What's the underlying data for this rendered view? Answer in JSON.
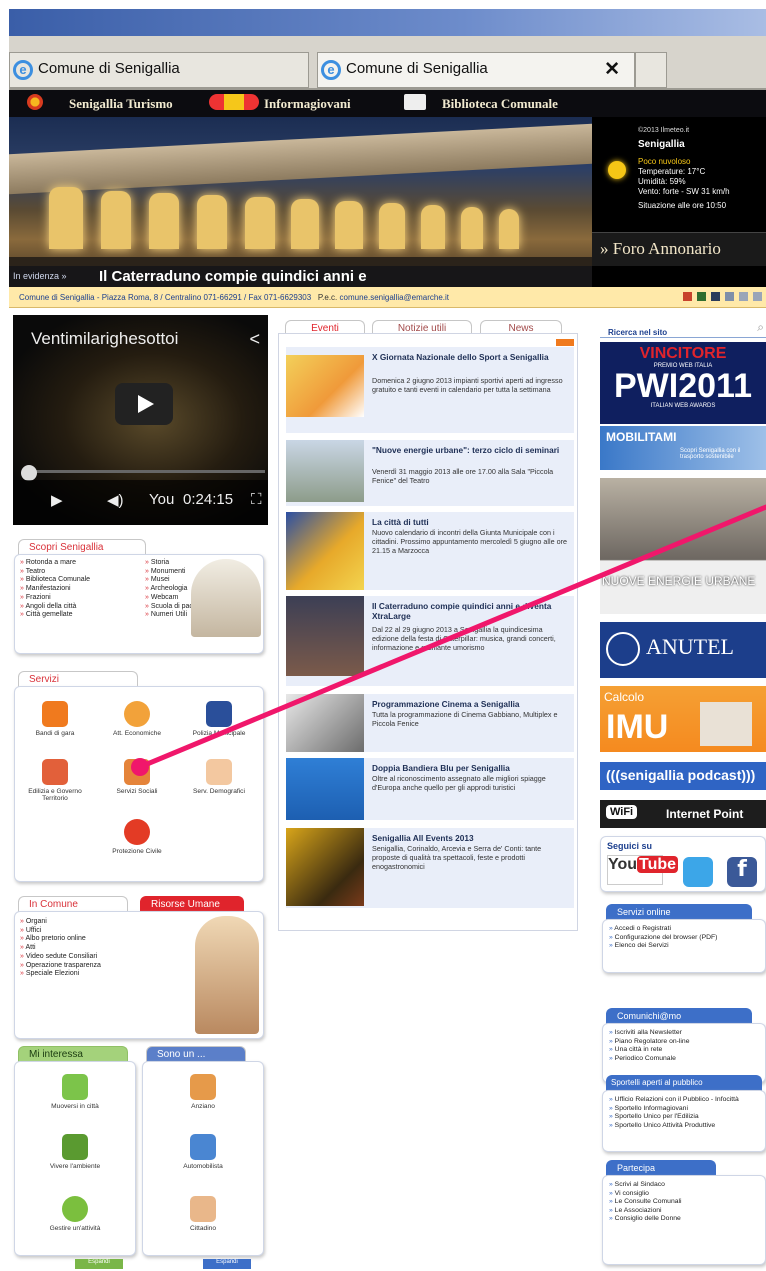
{
  "browser": {
    "tabs": [
      {
        "title": "Comune di Senigallia"
      },
      {
        "title": "Comune di Senigallia"
      }
    ],
    "close_glyph": "✕"
  },
  "topnav": {
    "items": [
      "Senigallia Turismo",
      "Informagiovani",
      "Biblioteca Comunale"
    ]
  },
  "meteo": {
    "copyright": "©2013 Ilmeteo.it",
    "city": "Senigallia",
    "condition": "Poco nuvoloso",
    "temp": "Temperature: 17°C",
    "humidity": "Umidità: 59%",
    "wind": "Vento: forte - SW 31 km/h",
    "updated": "Situazione alle ore 10:50"
  },
  "hero": {
    "place": "» Foro Annonario",
    "evidenza_label": "In evidenza »",
    "evidenza_title": "Il Caterraduno compie quindici anni e"
  },
  "address": {
    "text": "Comune di Senigallia - Piazza Roma, 8 / Centralino 071-66291 / Fax 071-6629303",
    "pec_label": "P.e.c.",
    "pec": "comune.senigallia@emarche.it"
  },
  "video": {
    "title": "Ventimilarighesottoi",
    "time": "0:24:15",
    "brand": "You"
  },
  "scopri": {
    "title": "Scopri Senigallia",
    "col1": [
      "Rotonda a mare",
      "Teatro",
      "Biblioteca Comunale",
      "Manifestazioni",
      "Frazioni",
      "Angoli della città",
      "Città gemellate"
    ],
    "col2": [
      "Storia",
      "Monumenti",
      "Musei",
      "Archeologia",
      "Webcam",
      "Scuola di pace",
      "Numeri Utili"
    ]
  },
  "servizi": {
    "title": "Servizi",
    "items": [
      "Bandi di gara",
      "Att. Economiche",
      "Polizia Municipale",
      "Edilizia e Governo Territorio",
      "Servizi Sociali",
      "Serv. Demografici",
      "Protezione Civile"
    ]
  },
  "in_comune": {
    "tab1": "In Comune",
    "tab2": "Risorse Umane",
    "items": [
      "Organi",
      "Uffici",
      "Albo pretorio online",
      "Atti",
      "Video sedute Consiliari",
      "Operazione trasparenza",
      "Speciale Elezioni"
    ]
  },
  "interessa": {
    "tab1": "Mi interessa",
    "tab2": "Sono un ...",
    "left": [
      "Muoversi in città",
      "Vivere l'ambiente",
      "Gestire un'attività"
    ],
    "right": [
      "Anziano",
      "Automobilista",
      "Cittadino"
    ],
    "expand": "Espandi"
  },
  "eventi": {
    "tabs": [
      "Eventi",
      "Notizie utili",
      "News"
    ],
    "items": [
      {
        "title": "X Giornata Nazionale dello Sport a Senigallia",
        "text": "Domenica 2 giugno 2013 impianti sportivi aperti ad ingresso gratuito e tanti eventi in calendario per tutta la settimana"
      },
      {
        "title": "\"Nuove energie urbane\": terzo ciclo di seminari",
        "text": "Venerdì 31 maggio 2013 alle ore 17.00 alla Sala \"Piccola Fenice\" del Teatro"
      },
      {
        "title": "La città di tutti",
        "text": "Nuovo calendario di incontri della Giunta Municipale con i cittadini. Prossimo appuntamento mercoledì 5 giugno alle ore 21.15 a Marzocca"
      },
      {
        "title": "Il Caterraduno compie quindici anni e diventa XtraLarge",
        "text": "Dal 22 al 29 giugno 2013 a Senigallia la quindicesima edizione della festa di Caterpillar: musica, grandi concerti, informazione e graffiante umorismo"
      },
      {
        "title": "Programmazione Cinema a Senigallia",
        "text": "Tutta la programmazione di Cinema Gabbiano, Multiplex e Piccola Fenice"
      },
      {
        "title": "Doppia Bandiera Blu per Senigallia",
        "text": "Oltre al riconoscimento assegnato alle migliori spiagge d'Europa anche quello per gli approdi turistici"
      },
      {
        "title": "Senigallia All Events 2013",
        "text": "Senigallia, Corinaldo, Arcevia e Serra de' Conti: tante proposte di qualità tra spettacoli, feste e prodotti enogastronomici"
      }
    ]
  },
  "sidebar": {
    "search_placeholder": "Ricerca nel sito",
    "pwi_top": "VINCITORE",
    "pwi_sub": "PREMIO WEB ITALIA",
    "pwi_big": "PWI2011",
    "pwi_foot": "ITALIAN WEB AWARDS",
    "mobilita": "MOBILITAMI",
    "mobilita_sub": "Scopri Senigallia con il trasporto sostenibile",
    "energie": "NUOVE ENERGIE URBANE",
    "anutel": "ANUTEL",
    "imu_label": "Calcolo",
    "imu": "IMU",
    "podcast": "(((senigallia podcast)))",
    "wifi": "Internet Point",
    "seguici": "Seguici su",
    "servizi_online": {
      "title": "Servizi online",
      "items": [
        "Accedi o Registrati",
        "Configurazione del browser (PDF)",
        "Elenco dei Servizi"
      ]
    },
    "comunichiamo": {
      "title": "Comunichi@mo",
      "items": [
        "Iscriviti alla Newsletter",
        "Piano Regolatore on-line",
        "Una città in rete",
        "Periodico Comunale"
      ]
    },
    "sportelli": {
      "title": "Sportelli aperti al pubblico",
      "items": [
        "Ufficio Relazioni con il Pubblico - Infocittà",
        "Sportello Informagiovani",
        "Sportello Unico per l'Edilizia",
        "Sportello Unico Attività Produttive"
      ]
    },
    "partecipa": {
      "title": "Partecipa",
      "items": [
        "Scrivi al Sindaco",
        "Vi consiglio",
        "Le Consulte Comunali",
        "Le Associazioni",
        "Consiglio delle Donne"
      ]
    }
  },
  "colors": {
    "accent_red": "#e0242c",
    "accent_blue": "#3d6fc8",
    "callout": "#f0176b"
  }
}
